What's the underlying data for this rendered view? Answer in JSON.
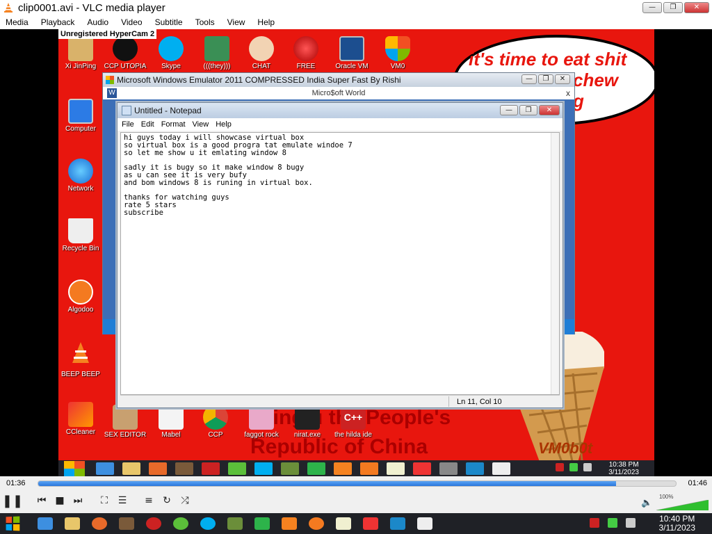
{
  "window": {
    "title": "clip0001.avi - VLC media player"
  },
  "menu": [
    "Media",
    "Playback",
    "Audio",
    "Video",
    "Subtitle",
    "Tools",
    "View",
    "Help"
  ],
  "video": {
    "watermark": "Unregistered HyperCam 2",
    "desktop_icons_left": [
      {
        "label": "Xi JinPing",
        "icon": "person-icon"
      },
      {
        "label": "Computer",
        "icon": "computer-icon"
      },
      {
        "label": "Network",
        "icon": "network-icon"
      },
      {
        "label": "Recycle Bin",
        "icon": "recycle-bin-icon"
      },
      {
        "label": "Algodoo",
        "icon": "algodoo-icon"
      },
      {
        "label": "BEEP BEEP",
        "icon": "vlc-cone-icon"
      },
      {
        "label": "CCleaner",
        "icon": "ccleaner-icon"
      }
    ],
    "desktop_icons_top": [
      {
        "label": "CCP UTOPIA"
      },
      {
        "label": "Skype"
      },
      {
        "label": "(((they)))"
      },
      {
        "label": "CHAT"
      },
      {
        "label": "FREE"
      },
      {
        "label": "Oracle VM"
      },
      {
        "label": "VM0"
      }
    ],
    "desktop_icons_bottom": [
      {
        "label": "SEX EDITOR"
      },
      {
        "label": "Mabel"
      },
      {
        "label": "CCP"
      },
      {
        "label": "faggot rock"
      },
      {
        "label": "nirat.exe"
      },
      {
        "label": "the hilda ide"
      }
    ],
    "bubble_text": "it's time to eat shit",
    "bubble_partial": [
      "chew",
      "g"
    ],
    "banner_text": [
      "nping u the People's",
      "Republic of China"
    ],
    "signature": "VM0b0t",
    "emulator": {
      "title": "Microsoft Windows Emulator 2011 COMPRESSED India Super Fast By Rishi",
      "subtitle": "Micro$oft World",
      "close": "x"
    },
    "notepad": {
      "title": "Untitled - Notepad",
      "menu": [
        "File",
        "Edit",
        "Format",
        "View",
        "Help"
      ],
      "text": "hi guys today i will showcase virtual box\nso virtual box is a good progra tat emulate windoe 7\nso let me show u it emlating window 8\n\nsadly it is bugy so it make window 8 bugy\nas u can see it is very bufy\nand bom windows 8 is runing in virtual box.\n\nthanks for watching guys\nrate 5 stars\nsubscribe",
      "status": "Ln 11, Col 10"
    },
    "inner_clock": {
      "time": "10:38 PM",
      "date": "3/11/2023"
    }
  },
  "playback": {
    "elapsed": "01:36",
    "total": "01:46",
    "progress": 0.906,
    "volume": "100%"
  },
  "taskbar": {
    "clock": {
      "time": "10:40 PM",
      "date": "3/11/2023"
    },
    "apps": [
      "ie-icon",
      "folder-icon",
      "firefox-icon",
      "paint-icon",
      "record-icon",
      "green-app-icon",
      "skype-icon",
      "minecraft-icon",
      "green-chat-icon",
      "vlc-icon",
      "algodoo-icon",
      "notepad-icon",
      "ccleaner-icon",
      "teamviewer-icon",
      "virtualbox-icon"
    ]
  }
}
